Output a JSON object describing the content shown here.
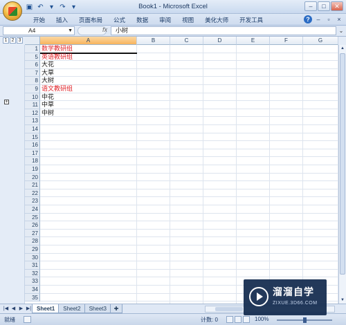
{
  "window": {
    "title": "Book1 - Microsoft Excel",
    "controls": [
      "–",
      "□",
      "✕"
    ]
  },
  "ribbon": {
    "tabs": [
      "开始",
      "插入",
      "页面布局",
      "公式",
      "数据",
      "审阅",
      "视图",
      "美化大师",
      "开发工具"
    ]
  },
  "formula_bar": {
    "name_box": "A4",
    "fx": "fx",
    "content": "小树"
  },
  "outline": {
    "levels": [
      "1",
      "2",
      "3"
    ],
    "collapse_button": "+"
  },
  "columns": [
    "A",
    "B",
    "C",
    "D",
    "E",
    "F",
    "G"
  ],
  "selected_column": "A",
  "rows": [
    {
      "row": "1",
      "a": "数学教研组",
      "style": "red"
    },
    {
      "row": "5",
      "a": "英语教研组",
      "style": "red"
    },
    {
      "row": "6",
      "a": "大花",
      "style": "black"
    },
    {
      "row": "7",
      "a": "大草",
      "style": "black"
    },
    {
      "row": "8",
      "a": "大树",
      "style": "black"
    },
    {
      "row": "9",
      "a": "语文教研组",
      "style": "red"
    },
    {
      "row": "10",
      "a": "中花",
      "style": "black"
    },
    {
      "row": "11",
      "a": "中草",
      "style": "black"
    },
    {
      "row": "12",
      "a": "中树",
      "style": "black"
    },
    {
      "row": "13",
      "a": "",
      "style": "black"
    },
    {
      "row": "14",
      "a": "",
      "style": "black"
    },
    {
      "row": "15",
      "a": "",
      "style": "black"
    },
    {
      "row": "16",
      "a": "",
      "style": "black"
    },
    {
      "row": "17",
      "a": "",
      "style": "black"
    },
    {
      "row": "18",
      "a": "",
      "style": "black"
    },
    {
      "row": "19",
      "a": "",
      "style": "black"
    },
    {
      "row": "20",
      "a": "",
      "style": "black"
    },
    {
      "row": "21",
      "a": "",
      "style": "black"
    },
    {
      "row": "22",
      "a": "",
      "style": "black"
    },
    {
      "row": "23",
      "a": "",
      "style": "black"
    },
    {
      "row": "24",
      "a": "",
      "style": "black"
    },
    {
      "row": "25",
      "a": "",
      "style": "black"
    },
    {
      "row": "26",
      "a": "",
      "style": "black"
    },
    {
      "row": "27",
      "a": "",
      "style": "black"
    },
    {
      "row": "28",
      "a": "",
      "style": "black"
    },
    {
      "row": "29",
      "a": "",
      "style": "black"
    },
    {
      "row": "30",
      "a": "",
      "style": "black"
    },
    {
      "row": "31",
      "a": "",
      "style": "black"
    },
    {
      "row": "32",
      "a": "",
      "style": "black"
    },
    {
      "row": "33",
      "a": "",
      "style": "black"
    },
    {
      "row": "34",
      "a": "",
      "style": "black"
    },
    {
      "row": "35",
      "a": "",
      "style": "black"
    }
  ],
  "sheets": [
    "Sheet1",
    "Sheet2",
    "Sheet3"
  ],
  "active_sheet": "Sheet1",
  "status": {
    "mode": "就绪",
    "count": "计数: 0",
    "zoom": "100%"
  },
  "watermark": {
    "title": "溜溜自学",
    "subtitle": "ZIXUE.3D66.COM"
  },
  "colors": {
    "accent_red": "#e0242a",
    "selection_orange": "#f8b45d",
    "watermark_bg": "#122a4e"
  }
}
